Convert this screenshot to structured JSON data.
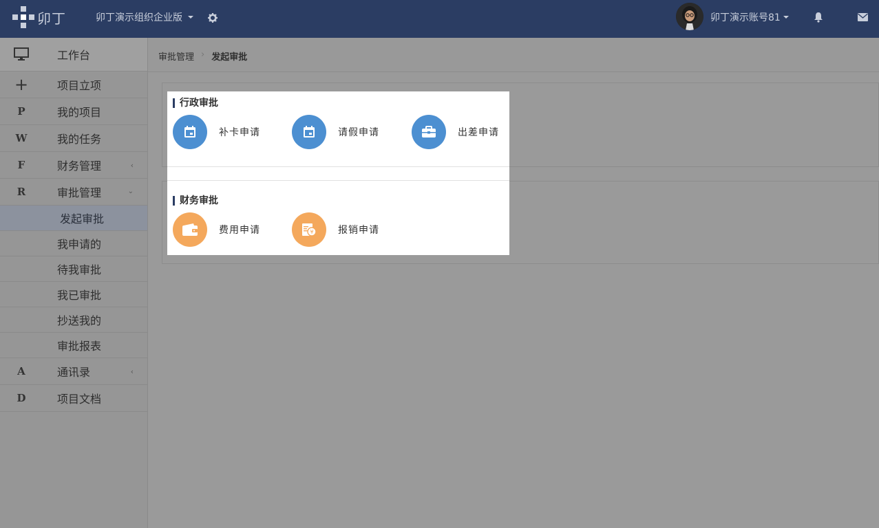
{
  "header": {
    "logo_text": "卯丁",
    "org_name": "卯丁演示组织企业版",
    "account_name": "卯丁演示账号81"
  },
  "sidebar": {
    "workbench": "工作台",
    "items": [
      {
        "icon": "+",
        "label": "项目立项"
      },
      {
        "icon": "P",
        "label": "我的项目"
      },
      {
        "icon": "W",
        "label": "我的任务"
      },
      {
        "icon": "F",
        "label": "财务管理"
      },
      {
        "icon": "R",
        "label": "审批管理"
      }
    ],
    "approval_sub": [
      {
        "label": "发起审批",
        "active": true
      },
      {
        "label": "我申请的"
      },
      {
        "label": "待我审批"
      },
      {
        "label": "我已审批"
      },
      {
        "label": "抄送我的"
      },
      {
        "label": "审批报表"
      }
    ],
    "items_after": [
      {
        "icon": "A",
        "label": "通讯录"
      },
      {
        "icon": "D",
        "label": "项目文档"
      }
    ]
  },
  "breadcrumb": {
    "parent": "审批管理",
    "current": "发起审批"
  },
  "sections": [
    {
      "title": "行政审批",
      "apps": [
        {
          "label": "补卡申请",
          "icon": "calendar-icon",
          "color": "#4c8fd1"
        },
        {
          "label": "请假申请",
          "icon": "calendar-icon",
          "color": "#4c8fd1"
        },
        {
          "label": "出差申请",
          "icon": "briefcase-icon",
          "color": "#4c8fd1"
        }
      ]
    },
    {
      "title": "财务审批",
      "apps": [
        {
          "label": "费用申请",
          "icon": "wallet-icon",
          "color": "#f4a85c"
        },
        {
          "label": "报销申请",
          "icon": "receipt-yen-icon",
          "color": "#f4a85c"
        }
      ]
    }
  ]
}
